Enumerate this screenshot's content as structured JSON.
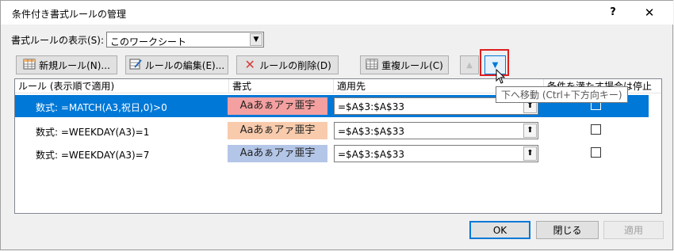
{
  "window": {
    "title": "条件付き書式ルールの管理",
    "help": "?",
    "close": "✕"
  },
  "show_rules": {
    "label": "書式ルールの表示(S):",
    "value": "このワークシート"
  },
  "toolbar": {
    "new_rule": "新規ルール(N)...",
    "edit_rule": "ルールの編集(E)...",
    "delete_rule": "ルールの削除(D)",
    "duplicate_rule": "重複ルール(C)",
    "move_up": "▲",
    "move_down": "▼"
  },
  "columns": {
    "rule": "ルール (表示順で適用)",
    "format": "書式",
    "applies_to": "適用先",
    "stop_if_true": "条件を満たす場合は停止"
  },
  "rules": [
    {
      "rule": "数式: =MATCH(A3,祝日,0)>0",
      "format_sample": "Aaあぁアァ亜宇",
      "format_color": "#f4a0a0",
      "applies_to": "=$A$3:$A$33",
      "stop_if_true": false,
      "selected": true
    },
    {
      "rule": "数式: =WEEKDAY(A3)=1",
      "format_sample": "Aaあぁアァ亜宇",
      "format_color": "#f8cbad",
      "applies_to": "=$A$3:$A$33",
      "stop_if_true": false,
      "selected": false
    },
    {
      "rule": "数式: =WEEKDAY(A3)=7",
      "format_sample": "Aaあぁアァ亜宇",
      "format_color": "#b4c6e7",
      "applies_to": "=$A$3:$A$33",
      "stop_if_true": false,
      "selected": false
    }
  ],
  "tooltip": "下へ移動 (Ctrl+下方向キー)",
  "footer": {
    "ok": "OK",
    "close": "閉じる",
    "apply": "適用"
  },
  "icons": [
    "new-rule-icon",
    "edit-rule-icon",
    "delete-rule-icon",
    "duplicate-rule-icon",
    "collapse-dialog-icon",
    "chevron-down-icon",
    "mouse-cursor-icon"
  ]
}
